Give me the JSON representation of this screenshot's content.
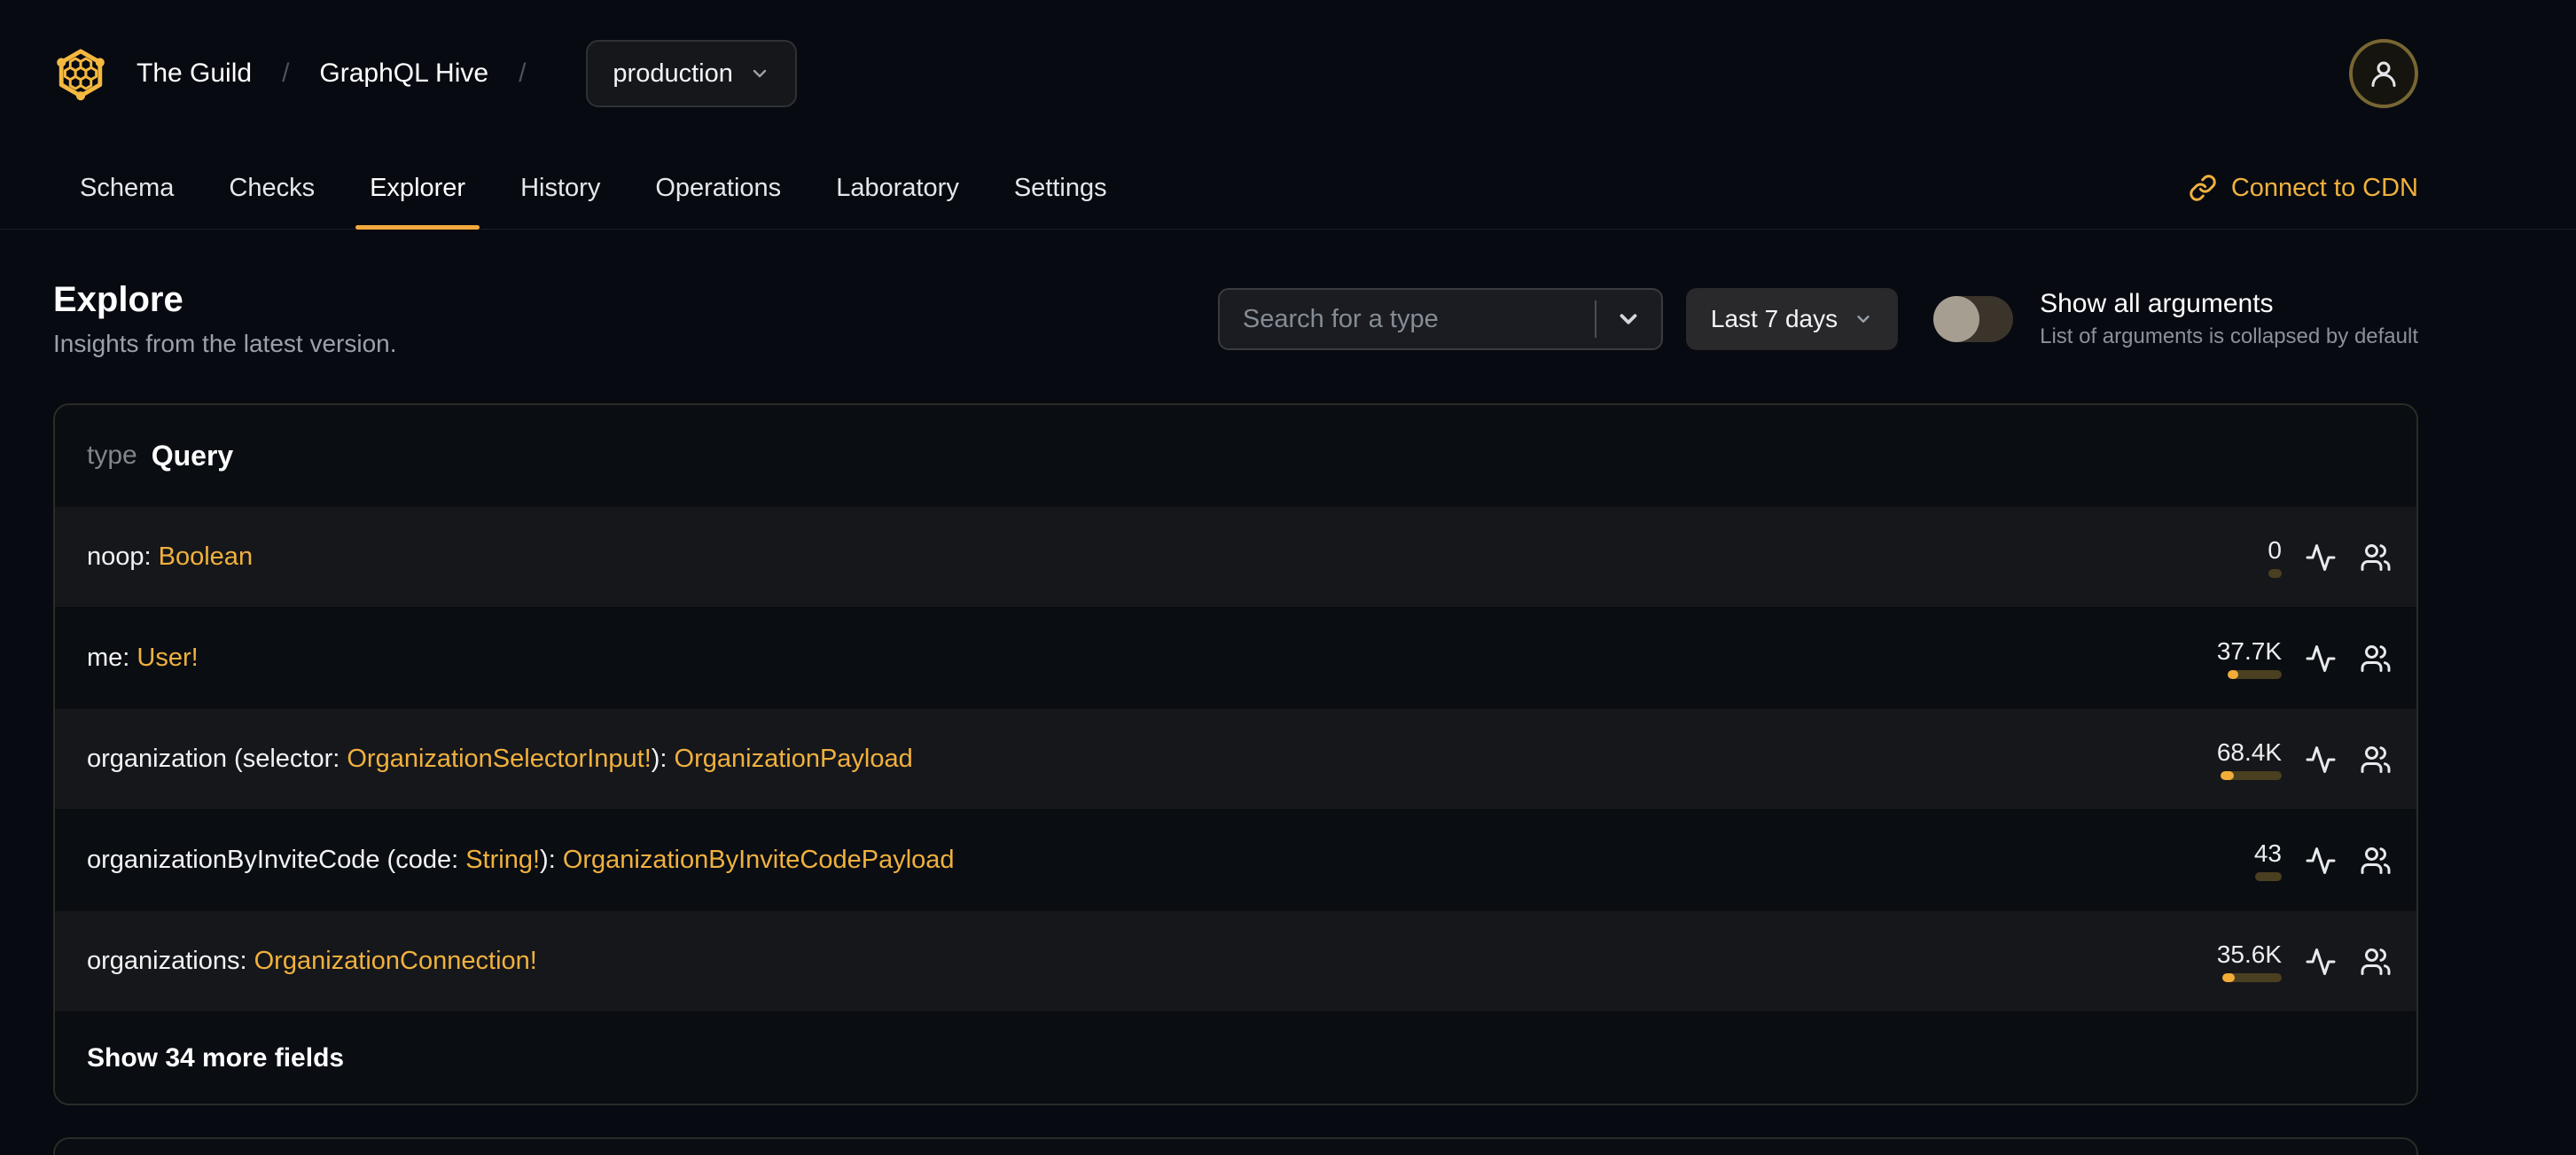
{
  "colors": {
    "accent": "#f0b13e",
    "logo": "#f5b840",
    "tab_underline": "#f2a93e",
    "bar_fill": "#f1ad38",
    "bar_track": "#4a3f20",
    "page_background": "#070a10",
    "row_highlight": "#16171b"
  },
  "header": {
    "breadcrumb": {
      "org": "The Guild",
      "sep": "/",
      "project": "GraphQL Hive",
      "target": "production"
    },
    "avatar_icon": "user-icon",
    "logo_icon": "hive-logo"
  },
  "tabs": [
    {
      "label": "Schema"
    },
    {
      "label": "Checks"
    },
    {
      "label": "Explorer"
    },
    {
      "label": "History"
    },
    {
      "label": "Operations"
    },
    {
      "label": "Laboratory"
    },
    {
      "label": "Settings"
    }
  ],
  "active_tab": "Explorer",
  "cdn_link": {
    "label": "Connect to CDN",
    "icon": "link-icon"
  },
  "page": {
    "title": "Explore",
    "subtitle": "Insights from the latest version."
  },
  "controls": {
    "search": {
      "placeholder": "Search for a type",
      "icon": "chevron-down-icon"
    },
    "period": {
      "label": "Last 7 days",
      "icon": "chevron-down-icon"
    },
    "arguments_toggle": {
      "label": "Show all arguments",
      "hint": "List of arguments is collapsed by default",
      "state": "off"
    }
  },
  "type_card": {
    "kind_label": "type",
    "type_name": "Query",
    "row_icons": [
      "activity-icon",
      "users-icon"
    ],
    "fields": [
      {
        "t1": "noop: ",
        "a1": "Boolean",
        "t2": "",
        "a2": "",
        "count": "0",
        "bar_style": "width:15px",
        "fill_style": "width:0px"
      },
      {
        "t1": "me: ",
        "a1": "User!",
        "t2": "",
        "a2": "",
        "count": "37.7K",
        "bar_style": "width:61px",
        "fill_style": "width:12px"
      },
      {
        "t1": "organization (selector: ",
        "a1": "OrganizationSelectorInput!",
        "t2": "): ",
        "a2": "OrganizationPayload",
        "count": "68.4K",
        "bar_style": "width:69px",
        "fill_style": "width:15px"
      },
      {
        "t1": "organizationByInviteCode (code: ",
        "a1": "String!",
        "t2": "): ",
        "a2": "OrganizationByInviteCodePayload",
        "count": "43",
        "bar_style": "width:30px",
        "fill_style": "width:0px"
      },
      {
        "t1": "organizations: ",
        "a1": "OrganizationConnection!",
        "t2": "",
        "a2": "",
        "count": "35.6K",
        "bar_style": "width:67px",
        "fill_style": "width:14px"
      }
    ],
    "show_more": "Show 34 more fields"
  }
}
